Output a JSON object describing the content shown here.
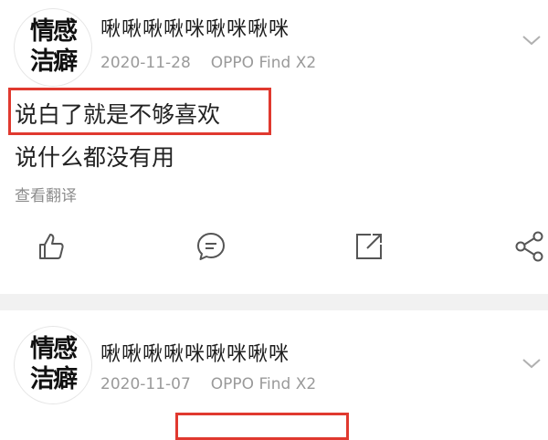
{
  "posts": [
    {
      "avatar_text": [
        "情感",
        "洁癖"
      ],
      "username": "啾啾啾啾咪啾咪啾咪",
      "date": "2020-11-28",
      "device": "OPPO Find X2",
      "lines": [
        "说白了就是不够喜欢",
        "说什么都没有用"
      ],
      "highlighted_line": "说白了就是不够喜欢",
      "translate_label": "查看翻译",
      "actions": [
        "like-icon",
        "comment-icon",
        "share-icon",
        "more-share-icon"
      ]
    },
    {
      "avatar_text": [
        "情感",
        "洁癖"
      ],
      "username": "啾啾啾啾咪啾咪啾咪",
      "date": "2020-11-07",
      "device": "OPPO Find X2"
    }
  ],
  "colors": {
    "highlight": "#e0392f",
    "meta": "#9a9a9a",
    "separator": "#f1f1f1"
  }
}
